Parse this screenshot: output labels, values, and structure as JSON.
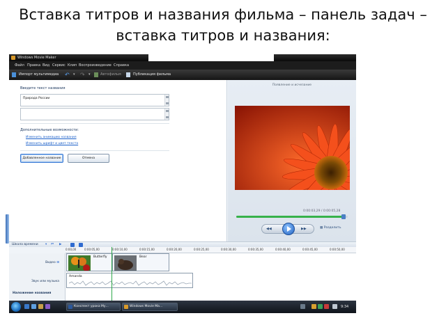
{
  "slide_title": "Вставка титров и названия фильма – панель задач – вставка титров и названия:",
  "window": {
    "title": "Windows Movie Maker"
  },
  "menu": [
    "Файл",
    "Правка",
    "Вид",
    "Сервис",
    "Клип",
    "Воспроизведение",
    "Справка"
  ],
  "toolbar": {
    "import": "Импорт мультимедиа",
    "autofilm": "Автофильм",
    "publish": "Публикация фильма"
  },
  "task": {
    "label": "Введите текст названия",
    "value": "Природа России",
    "more_options": "Дополнительные возможности:",
    "links": [
      "Изменить анимацию названия",
      "Изменить шрифт и цвет текста"
    ],
    "btn_add": "Добавленное название",
    "btn_cancel": "Отмена"
  },
  "preview": {
    "title": "Появление и исчезание",
    "time": "0:00:03,29 / 0:00:05,28",
    "split": "Разделить",
    "progress": 0.98
  },
  "timeline": {
    "label": "Шкала времени",
    "ticks": [
      "0:00,00",
      "0:00:05,00",
      "0:00:10,00",
      "0:00:15,00",
      "0:00:20,00",
      "0:00:25,00",
      "0:00:30,00",
      "0:00:35,00",
      "0:00:40,00",
      "0:00:45,00",
      "0:00:50,00"
    ],
    "tracks": {
      "video": "Видео",
      "audio": "Звук или музыка",
      "overlay": "Наложение названия"
    },
    "clips": [
      "Butterfly",
      "Bear"
    ],
    "audio_clip": "Amanda"
  },
  "taskbar": {
    "items": [
      "Конспект урока Му...",
      "Windows Movie Ma..."
    ],
    "clock": "9:34"
  },
  "colors": {
    "accent": "#2f6bd0",
    "playhead": "#2fa84a",
    "flower": "#e0391a"
  }
}
